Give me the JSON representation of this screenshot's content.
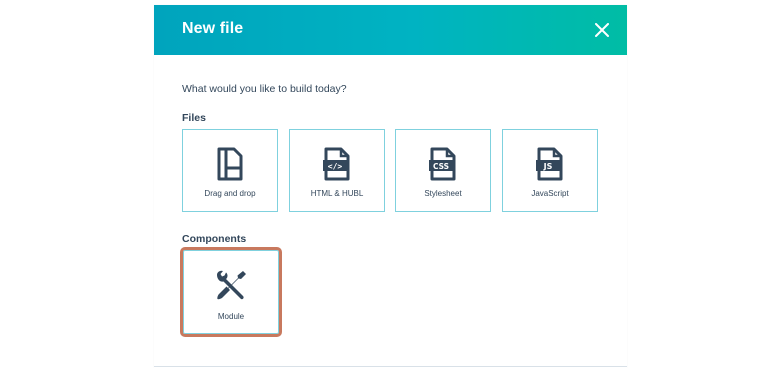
{
  "dialog": {
    "title": "New file",
    "close_label": "close",
    "prompt": "What would you like to build today?",
    "colors": {
      "header_start": "#00a4bd",
      "header_end": "#00bda5",
      "tile_border": "#7fd1de",
      "highlight": "#c8795e",
      "text": "#33475b"
    }
  },
  "files": {
    "heading": "Files",
    "items": [
      {
        "label": "Drag and drop",
        "icon": "drag-and-drop-icon"
      },
      {
        "label": "HTML & HUBL",
        "icon": "html-file-icon"
      },
      {
        "label": "Stylesheet",
        "icon": "css-file-icon"
      },
      {
        "label": "JavaScript",
        "icon": "js-file-icon"
      }
    ]
  },
  "components": {
    "heading": "Components",
    "items": [
      {
        "label": "Module",
        "icon": "wrench-screwdriver-icon"
      }
    ]
  },
  "icons": {
    "html_glyph": "</>",
    "css_glyph": "CSS",
    "js_glyph": "JS"
  }
}
